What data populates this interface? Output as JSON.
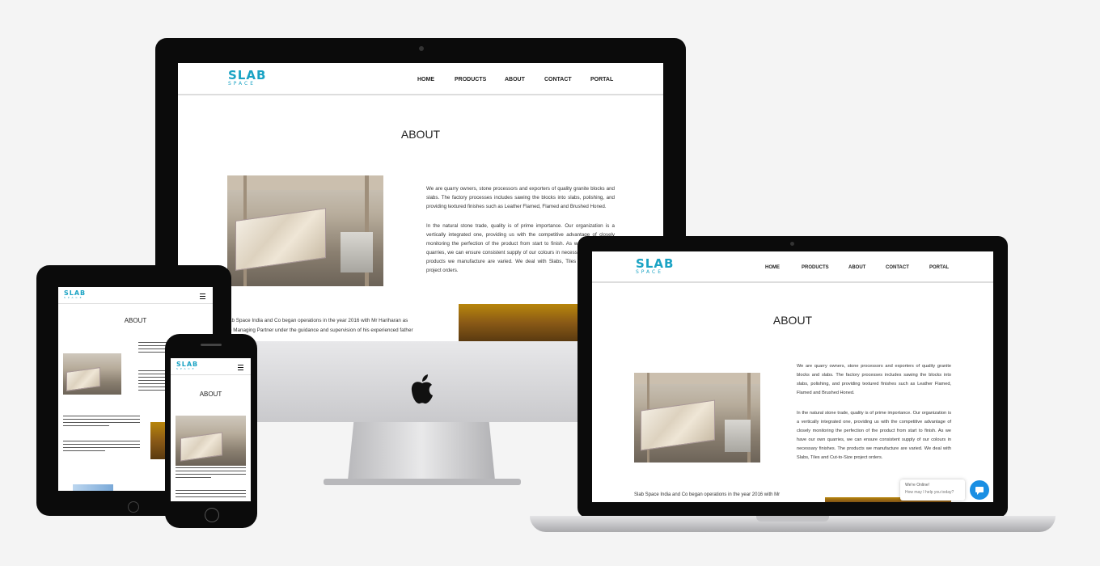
{
  "brand": {
    "name": "SLAB",
    "tagline": "SPACE",
    "accent": "#1aa3c4"
  },
  "nav": {
    "items": [
      "HOME",
      "PRODUCTS",
      "ABOUT",
      "CONTACT",
      "PORTAL"
    ]
  },
  "about": {
    "heading": "ABOUT",
    "para1": "We are quarry owners, stone processors and exporters of quality granite blocks and slabs. The factory processes includes sawing the blocks into slabs, polishing, and providing textured finishes such as Leather Flamed, Flamed and Brushed Honed.",
    "para2": "In the natural stone trade, quality is of prime importance. Our organization is a vertically integrated one, providing us with the competitive advantage of closely monitoring the perfection of the product from start to finish. As we have our own quarries, we can ensure consistent supply of our colours in necessary finishes. The products we manufacture are varied. We deal with Slabs, Tiles and Cut-to-Size project orders.",
    "para3": "Slab Space India and Co began operations in the year 2016 with Mr Hariharan as the Managing Partner under the guidance and supervision of his experienced father",
    "para3_desktop_partial": "ab Space India and Co began operations in the year 2016 with Mr Hariharan as",
    "para3_desktop_partial2": "e Managing Partner under the guidance and supervision of his experienced father",
    "para3_laptop_partial": "Slab Space India and Co began operations in the year 2016 with Mr"
  },
  "chat": {
    "line1": "We're Online!",
    "line2": "How may I help you today?"
  }
}
